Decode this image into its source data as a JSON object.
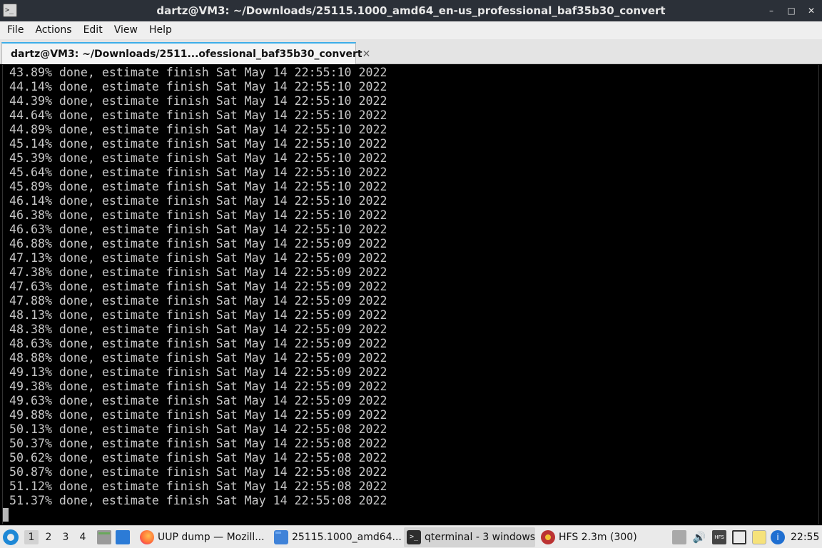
{
  "window": {
    "title": "dartz@VM3: ~/Downloads/25115.1000_amd64_en-us_professional_baf35b30_convert",
    "app_icon_glyph": ">_",
    "controls": {
      "minimize": "–",
      "maximize": "□",
      "close": "✕"
    }
  },
  "menubar": {
    "items": [
      "File",
      "Actions",
      "Edit",
      "View",
      "Help"
    ]
  },
  "tabs": [
    {
      "label": "dartz@VM3: ~/Downloads/2511...ofessional_baf35b30_convert",
      "close": "✕",
      "active": true
    }
  ],
  "terminal": {
    "lines": [
      "43.89% done, estimate finish Sat May 14 22:55:10 2022",
      "44.14% done, estimate finish Sat May 14 22:55:10 2022",
      "44.39% done, estimate finish Sat May 14 22:55:10 2022",
      "44.64% done, estimate finish Sat May 14 22:55:10 2022",
      "44.89% done, estimate finish Sat May 14 22:55:10 2022",
      "45.14% done, estimate finish Sat May 14 22:55:10 2022",
      "45.39% done, estimate finish Sat May 14 22:55:10 2022",
      "45.64% done, estimate finish Sat May 14 22:55:10 2022",
      "45.89% done, estimate finish Sat May 14 22:55:10 2022",
      "46.14% done, estimate finish Sat May 14 22:55:10 2022",
      "46.38% done, estimate finish Sat May 14 22:55:10 2022",
      "46.63% done, estimate finish Sat May 14 22:55:10 2022",
      "46.88% done, estimate finish Sat May 14 22:55:09 2022",
      "47.13% done, estimate finish Sat May 14 22:55:09 2022",
      "47.38% done, estimate finish Sat May 14 22:55:09 2022",
      "47.63% done, estimate finish Sat May 14 22:55:09 2022",
      "47.88% done, estimate finish Sat May 14 22:55:09 2022",
      "48.13% done, estimate finish Sat May 14 22:55:09 2022",
      "48.38% done, estimate finish Sat May 14 22:55:09 2022",
      "48.63% done, estimate finish Sat May 14 22:55:09 2022",
      "48.88% done, estimate finish Sat May 14 22:55:09 2022",
      "49.13% done, estimate finish Sat May 14 22:55:09 2022",
      "49.38% done, estimate finish Sat May 14 22:55:09 2022",
      "49.63% done, estimate finish Sat May 14 22:55:09 2022",
      "49.88% done, estimate finish Sat May 14 22:55:09 2022",
      "50.13% done, estimate finish Sat May 14 22:55:08 2022",
      "50.37% done, estimate finish Sat May 14 22:55:08 2022",
      "50.62% done, estimate finish Sat May 14 22:55:08 2022",
      "50.87% done, estimate finish Sat May 14 22:55:08 2022",
      "51.12% done, estimate finish Sat May 14 22:55:08 2022",
      "51.37% done, estimate finish Sat May 14 22:55:08 2022"
    ]
  },
  "taskbar": {
    "desktops": [
      "1",
      "2",
      "3",
      "4"
    ],
    "active_desktop": "1",
    "tasks": [
      {
        "label": "UUP dump — Mozill...",
        "icon": "firefox-icon"
      },
      {
        "label": "25115.1000_amd64...",
        "icon": "folder-icon"
      },
      {
        "label": "qterminal - 3 windows",
        "icon": "terminal-icon"
      },
      {
        "label": "HFS 2.3m (300)",
        "icon": "hfs-icon"
      }
    ],
    "tray": {
      "volume_glyph": "🔊",
      "hfs_badge": "HFS",
      "update_glyph": "i"
    },
    "clock": "22:55"
  },
  "colors": {
    "titlebar_bg": "#2b3038",
    "terminal_bg": "#000000",
    "terminal_fg": "#c8c8c8",
    "tab_accent": "#3daee9",
    "taskbar_bg": "#eaeaea"
  }
}
